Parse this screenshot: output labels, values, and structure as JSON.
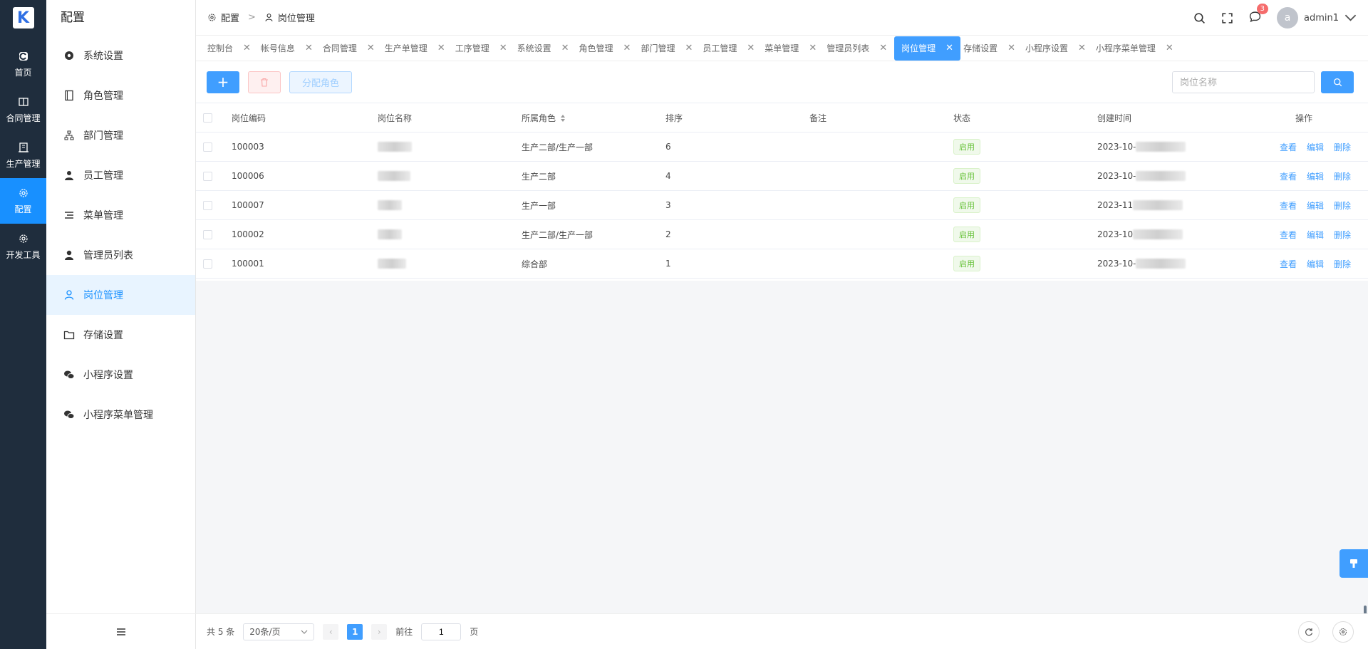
{
  "rail": {
    "logo": "K",
    "items": [
      {
        "label": "首页",
        "icon": "home-icon"
      },
      {
        "label": "合同管理",
        "icon": "book-icon"
      },
      {
        "label": "生产管理",
        "icon": "building-icon"
      },
      {
        "label": "配置",
        "icon": "gear-icon"
      },
      {
        "label": "开发工具",
        "icon": "gear-icon"
      }
    ]
  },
  "menu": {
    "title": "配置",
    "items": [
      {
        "label": "系统设置",
        "icon": "gear-icon"
      },
      {
        "label": "角色管理",
        "icon": "notebook-icon"
      },
      {
        "label": "部门管理",
        "icon": "org-chart-icon"
      },
      {
        "label": "员工管理",
        "icon": "user-icon"
      },
      {
        "label": "菜单管理",
        "icon": "list-icon"
      },
      {
        "label": "管理员列表",
        "icon": "user-icon"
      },
      {
        "label": "岗位管理",
        "icon": "user-outline-icon"
      },
      {
        "label": "存储设置",
        "icon": "folder-icon"
      },
      {
        "label": "小程序设置",
        "icon": "wechat-icon"
      },
      {
        "label": "小程序菜单管理",
        "icon": "wechat-icon"
      }
    ]
  },
  "breadcrumb": {
    "root": "配置",
    "current": "岗位管理"
  },
  "header": {
    "notifications": "3",
    "avatar_letter": "a",
    "username": "admin1"
  },
  "tabs": [
    "控制台",
    "帐号信息",
    "合同管理",
    "生产单管理",
    "工序管理",
    "系统设置",
    "角色管理",
    "部门管理",
    "员工管理",
    "菜单管理",
    "管理员列表",
    "岗位管理",
    "存储设置",
    "小程序设置",
    "小程序菜单管理"
  ],
  "toolbar": {
    "add": "+",
    "assign": "分配角色",
    "search_placeholder": "岗位名称"
  },
  "table": {
    "headers": {
      "code": "岗位编码",
      "name": "岗位名称",
      "role": "所属角色",
      "sort": "排序",
      "remark": "备注",
      "status": "状态",
      "created": "创建时间",
      "ops": "操作"
    },
    "rows": [
      {
        "code": "100003",
        "role": "生产二部/生产一部",
        "sort": "6",
        "status": "启用",
        "created": "2023-10-"
      },
      {
        "code": "100006",
        "role": "生产二部",
        "sort": "4",
        "status": "启用",
        "created": "2023-10-"
      },
      {
        "code": "100007",
        "role": "生产一部",
        "sort": "3",
        "status": "启用",
        "created": "2023-11"
      },
      {
        "code": "100002",
        "role": "生产二部/生产一部",
        "sort": "2",
        "status": "启用",
        "created": "2023-10"
      },
      {
        "code": "100001",
        "role": "综合部",
        "sort": "1",
        "status": "启用",
        "created": "2023-10-"
      }
    ],
    "ops": {
      "view": "查看",
      "edit": "编辑",
      "delete": "删除"
    }
  },
  "pagination": {
    "total": "共 5 条",
    "page_size": "20条/页",
    "current": "1",
    "goto_label": "前往",
    "goto_value": "1",
    "page_unit": "页"
  },
  "colors": {
    "primary": "#409eff",
    "rail_bg": "#1f2d3d",
    "rail_active": "#1890ff",
    "success": "#67c23a"
  }
}
